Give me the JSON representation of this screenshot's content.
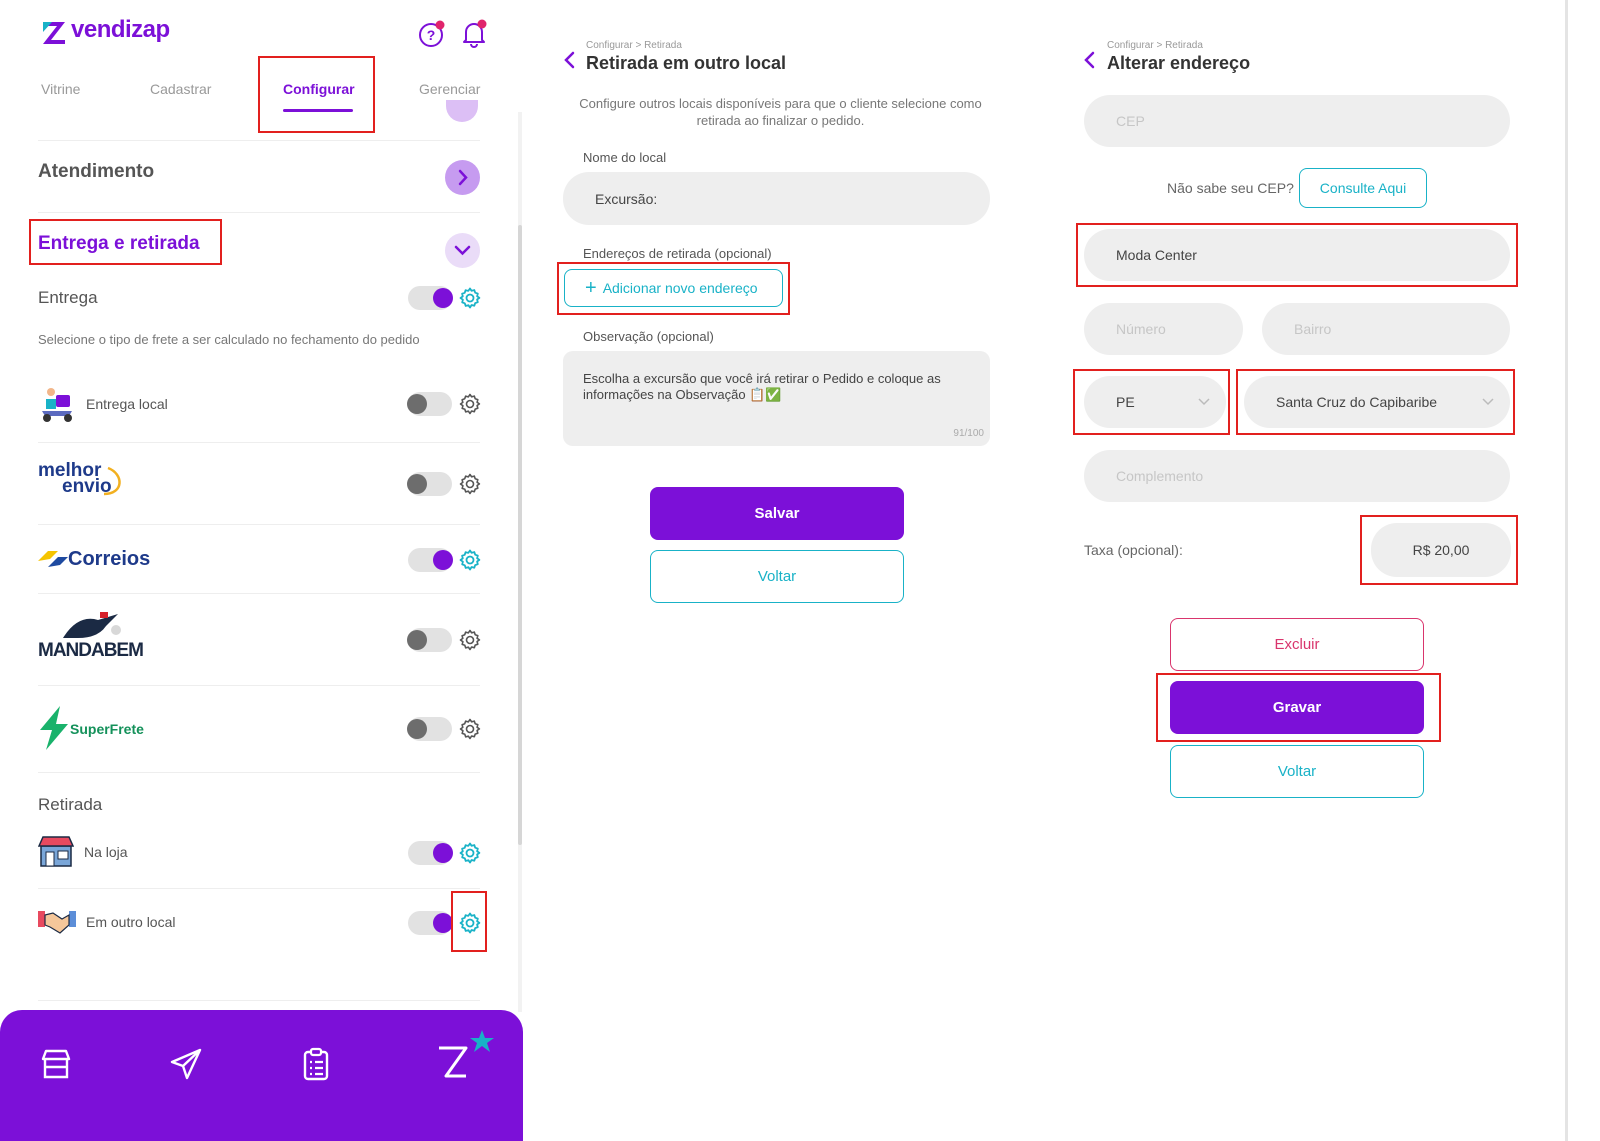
{
  "panel1": {
    "logo_text": "vendizap",
    "tabs": [
      "Vitrine",
      "Cadastrar",
      "Configurar",
      "Gerenciar"
    ],
    "atendimento": "Atendimento",
    "entrega_retirada": "Entrega e retirada",
    "entrega": "Entrega",
    "entrega_desc": "Selecione o tipo de frete a ser calculado no fechamento do pedido",
    "entrega_local": "Entrega local",
    "melhor_envio_line1": "melhor",
    "melhor_envio_line2": "envio",
    "correios": "Correios",
    "mandabem": "MANDABEM",
    "superfrete": "SuperFrete",
    "retirada": "Retirada",
    "na_loja": "Na loja",
    "em_outro_local": "Em outro local",
    "toggles": {
      "entrega": true,
      "entrega_local": false,
      "melhor_envio": false,
      "correios": true,
      "mandabem": false,
      "superfrete": false,
      "na_loja": true,
      "em_outro_local": true
    }
  },
  "panel2": {
    "breadcrumb": "Configurar > Retirada",
    "title": "Retirada em outro local",
    "description": "Configure outros locais disponíveis para que o cliente selecione como retirada ao finalizar o pedido.",
    "nome_label": "Nome do local",
    "nome_value": "Excursão:",
    "enderecos_label": "Endereços de retirada (opcional)",
    "add_button": "Adicionar novo endereço",
    "obs_label": "Observação (opcional)",
    "obs_value": "Escolha a excursão que você irá retirar o Pedido e coloque as informações na Observação 📋✅",
    "obs_counter": "91/100",
    "save": "Salvar",
    "back": "Voltar"
  },
  "panel3": {
    "breadcrumb": "Configurar > Retirada",
    "title": "Alterar endereço",
    "cep_placeholder": "CEP",
    "cep_help": "Não sabe seu CEP?",
    "consulte": "Consulte Aqui",
    "street_value": "Moda Center",
    "numero_placeholder": "Número",
    "bairro_placeholder": "Bairro",
    "uf_value": "PE",
    "city_value": "Santa Cruz do Capibaribe",
    "complemento_placeholder": "Complemento",
    "taxa_label": "Taxa (opcional):",
    "taxa_value": "R$ 20,00",
    "delete": "Excluir",
    "save": "Gravar",
    "back": "Voltar"
  },
  "colors": {
    "accent": "#7c10d8",
    "teal": "#19b2c7",
    "highlight": "#e2201e"
  }
}
